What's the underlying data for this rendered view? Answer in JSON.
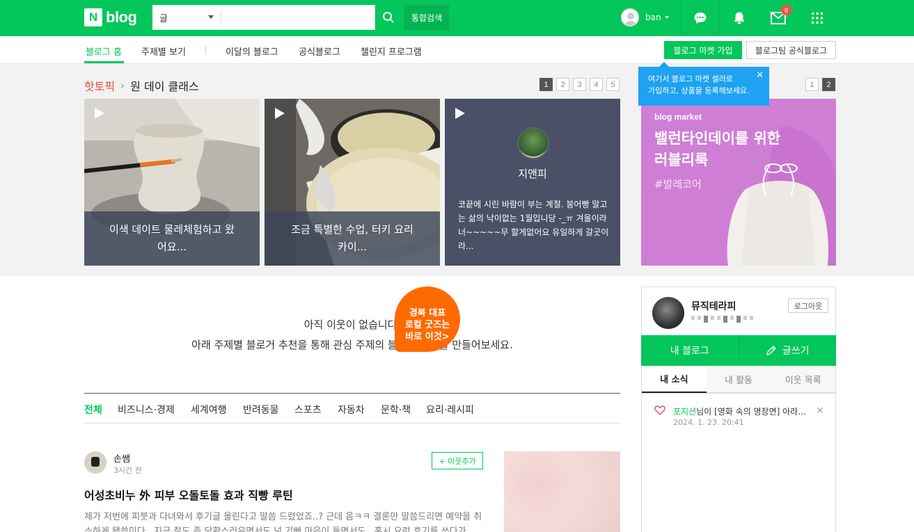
{
  "header": {
    "logo_letter": "N",
    "logo_text": "blog",
    "search_category": "글",
    "search_placeholder": "",
    "total_search": "통합검색",
    "username": "ban",
    "mail_badge": "8"
  },
  "nav": {
    "items": [
      "블로그 홈",
      "주제별 보기",
      "이달의 블로그",
      "공식블로그",
      "챌린지 프로그램"
    ],
    "market_join": "블로그 마켓 가입",
    "official_blog": "블로그팀 공식블로그"
  },
  "hot_topic": {
    "label": "핫토픽",
    "title": "원 데이 클래스",
    "pages": [
      "1",
      "2",
      "3",
      "4",
      "5"
    ],
    "active_page": "1",
    "cards": [
      {
        "caption": "이색 데이트 물레체험하고 왔어요..."
      },
      {
        "caption": "조금 특별한 수업, 터키 요리 카이..."
      },
      {
        "name": "지앤피",
        "desc": "코끝에 시린 바람이 부는 계절. 붕어빵 말고는 삶의 낙이없는 1월입니당 -_ㅠ 겨울이라 너~~~~~무 할게없어요 유일하게 갈곳이라..."
      }
    ]
  },
  "promo": {
    "pages": [
      "1",
      "2"
    ],
    "active_page": "2",
    "tooltip_line1": "여기서 블로그 마켓 셀러로",
    "tooltip_line2": "가입하고, 상품을 등록해보세요.",
    "brand": "blog market",
    "headline1": "밸런타인데이를 위한",
    "headline2": "러블리룩",
    "hashtag": "#발레코어"
  },
  "empty": {
    "line1": "아직 이웃이 없습니다.",
    "line2": "아래 주제별 블로거 추천을 통해 관심 주제의 블로그 이웃을 만들어보세요.",
    "bubble1": "경북 대표",
    "bubble2": "로컬 굿즈는",
    "bubble3": "바로 이것>"
  },
  "categories": [
    "전체",
    "비즈니스·경제",
    "세계여행",
    "반려동물",
    "스포츠",
    "자동차",
    "문학·책",
    "요리·레시피"
  ],
  "post": {
    "author": "손쌤",
    "time": "3시간 전",
    "follow": "+ 이웃추가",
    "title": "어성초비누 外 피부 오돌토돌 효과 직빵 루틴",
    "body": "제가 저번에 피붓과 다녀와서 후기글 올린다고 말씀 드렸었죠..? 근데 음ㅋㅋ 결론만 말씀드리면 예약을 취소하게 됐씁미다.. 지금 젊도 좀 당황스러우면서도 넘 기뻐 마음이 들면서도.. 혹시 요런 후기를 쓰다가"
  },
  "profile": {
    "name": "뮤직테라피",
    "logout": "로그아웃",
    "my_blog": "내 블로그",
    "write": "글쓰기",
    "tabs": [
      "내 소식",
      "내 활동",
      "이웃 목록"
    ],
    "noti_user": "포지션",
    "noti_text": "님이 [영화 속의 명장면] 아라한 장풍 대작전...",
    "noti_time": "2024. 1. 23. 20:41"
  },
  "colors": {
    "brand_green": "#03c75a",
    "tooltip_blue": "#1fa2f2",
    "promo_pink": "#cf7ed6",
    "hot_red": "#e94a3b"
  }
}
